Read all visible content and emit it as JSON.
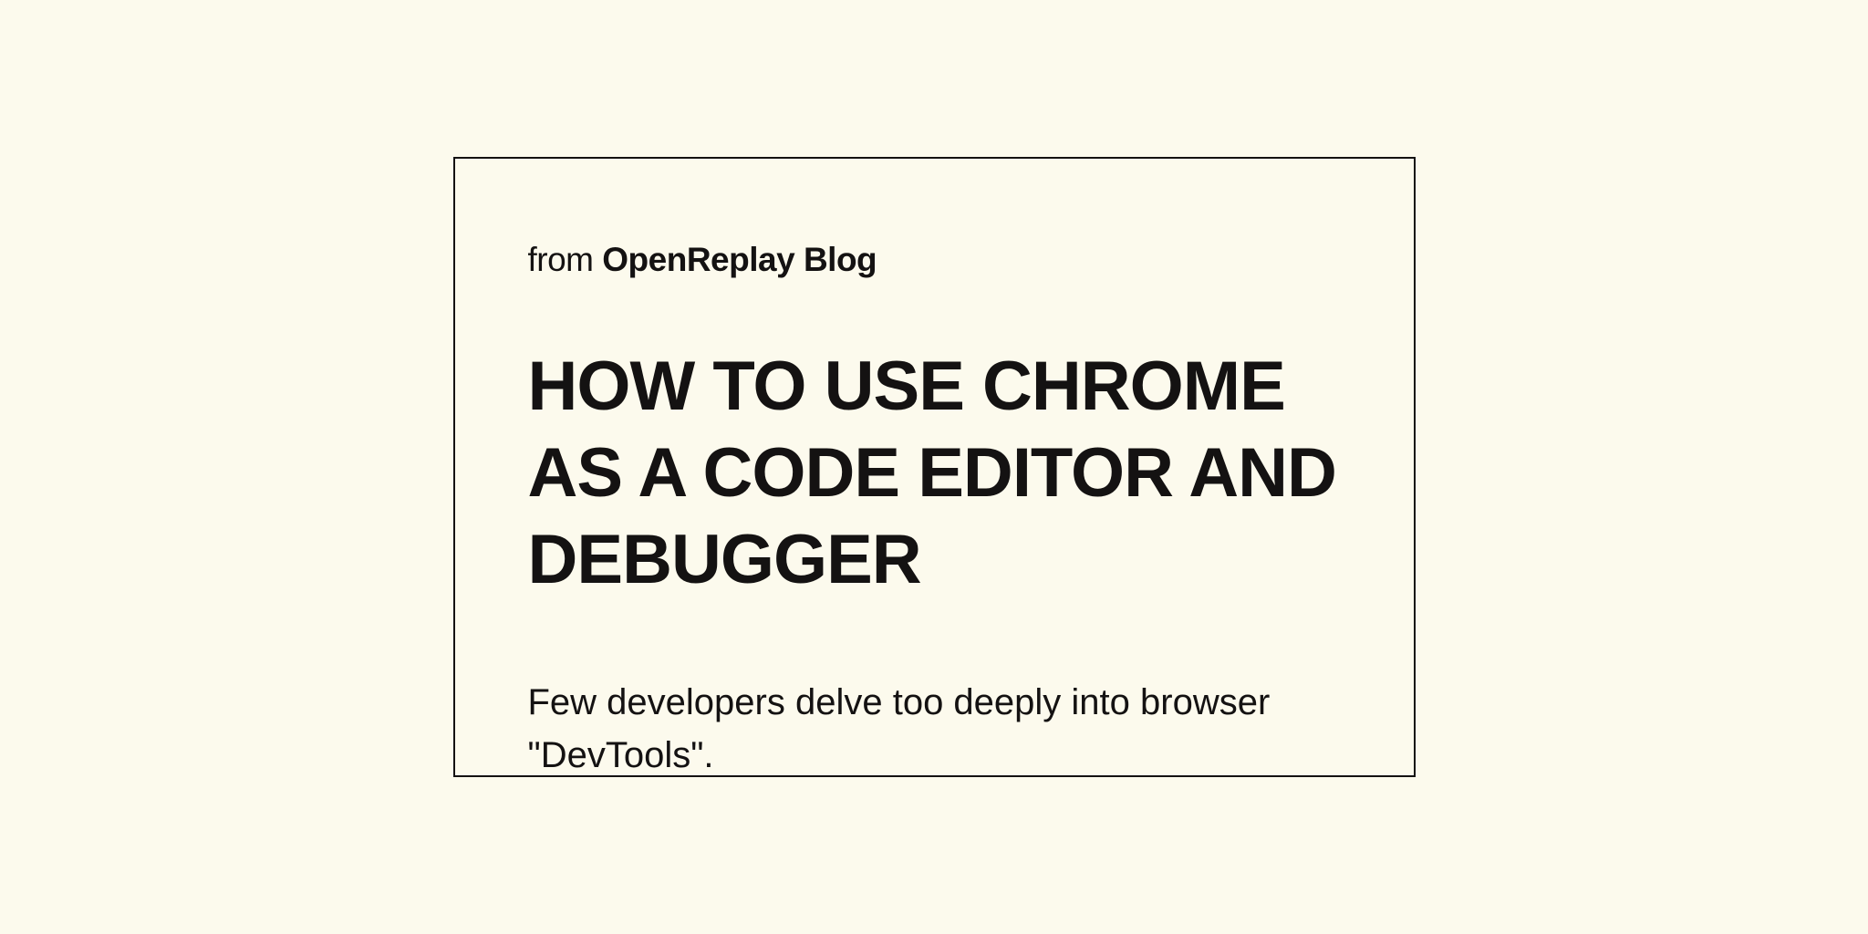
{
  "source": {
    "from_label": "from",
    "name": "OpenReplay Blog"
  },
  "title": "How to use Chrome as a Code Editor and Debugger",
  "excerpt": "Few developers delve too deeply into browser \"DevTools\"."
}
